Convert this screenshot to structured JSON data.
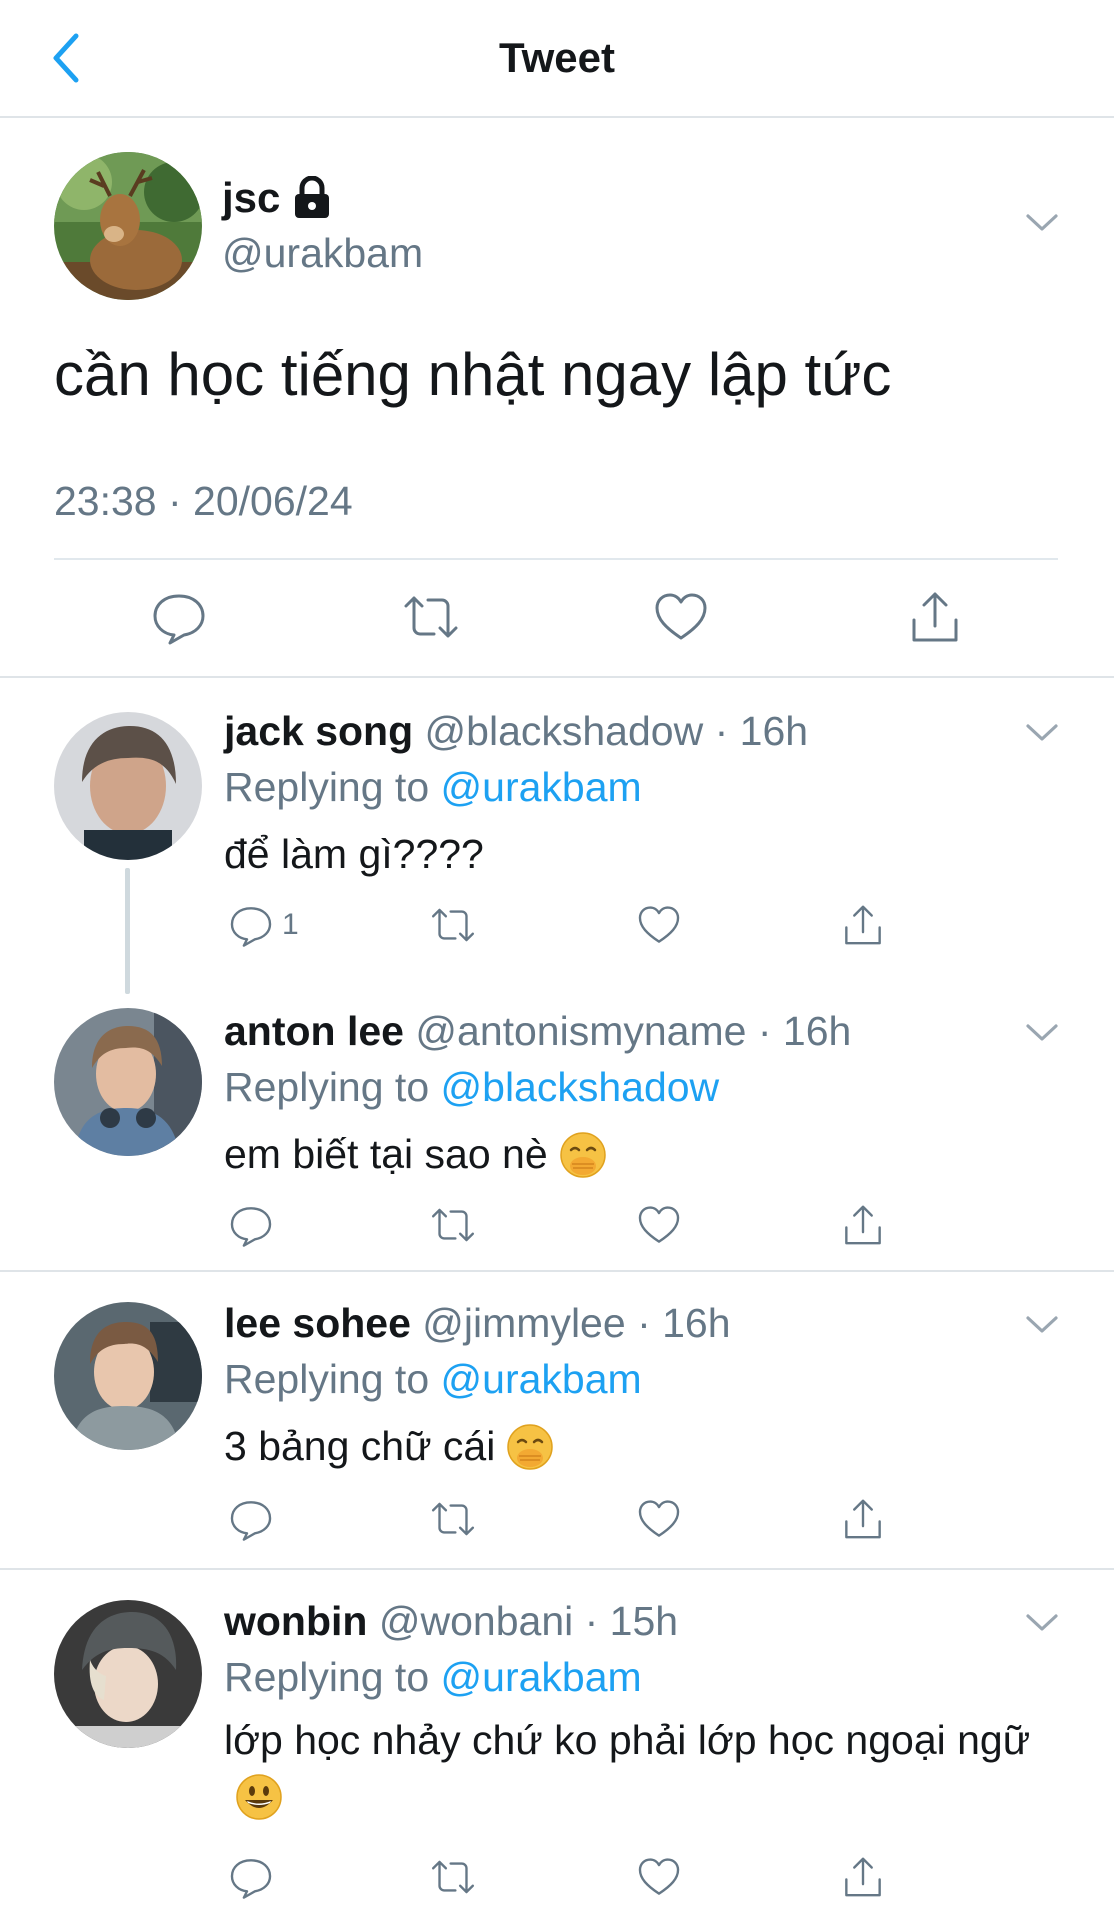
{
  "header": {
    "title": "Tweet"
  },
  "main_tweet": {
    "name": "jsc",
    "handle": "@urakbam",
    "text": "cần học tiếng nhật ngay lập tức",
    "timestamp": "23:38 · 20/06/24"
  },
  "replies": [
    {
      "name": "jack song",
      "handle": "@blackshadow",
      "time": "· 16h",
      "replying_prefix": "Replying to ",
      "replying_to": "@urakbam",
      "text": "để làm gì????",
      "reply_count": "1"
    },
    {
      "name": "anton lee",
      "handle": "@antonismyname",
      "time": "· 16h",
      "replying_prefix": "Replying to ",
      "replying_to": "@blackshadow",
      "text": "em biết tại sao nè",
      "emoji": "hand-over-mouth-emoji"
    },
    {
      "name": "lee sohee",
      "handle": "@jimmylee",
      "time": "· 16h",
      "replying_prefix": "Replying to ",
      "replying_to": "@urakbam",
      "text": "3 bảng chữ cái",
      "emoji": "hand-over-mouth-emoji"
    },
    {
      "name": "wonbin",
      "handle": "@wonbani",
      "time": "· 15h",
      "replying_prefix": "Replying to ",
      "replying_to": "@urakbam",
      "text": "lớp học nhảy chứ ko phải lớp học ngoại ngữ",
      "emoji": "grinning-face-emoji"
    }
  ],
  "colors": {
    "accent": "#1da1f2",
    "secondary_text": "#657786",
    "divider": "#dfe4e8"
  }
}
